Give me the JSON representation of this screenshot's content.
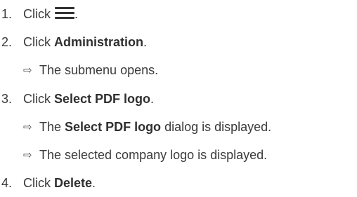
{
  "steps": [
    {
      "number": "1.",
      "prefix": "Click",
      "icon": "hamburger-menu-icon",
      "suffix": "."
    },
    {
      "number": "2.",
      "prefix": "Click ",
      "bold": "Administration",
      "suffix": ".",
      "results": [
        {
          "arrow": "⇨",
          "text": "The submenu opens."
        }
      ]
    },
    {
      "number": "3.",
      "prefix": "Click ",
      "bold": "Select PDF logo",
      "suffix": ".",
      "results": [
        {
          "arrow": "⇨",
          "pre": "The ",
          "bold": "Select PDF logo",
          "post": " dialog is displayed."
        },
        {
          "arrow": "⇨",
          "text": "The selected company logo is displayed."
        }
      ]
    },
    {
      "number": "4.",
      "prefix": "Click ",
      "bold": "Delete",
      "suffix": "."
    }
  ]
}
